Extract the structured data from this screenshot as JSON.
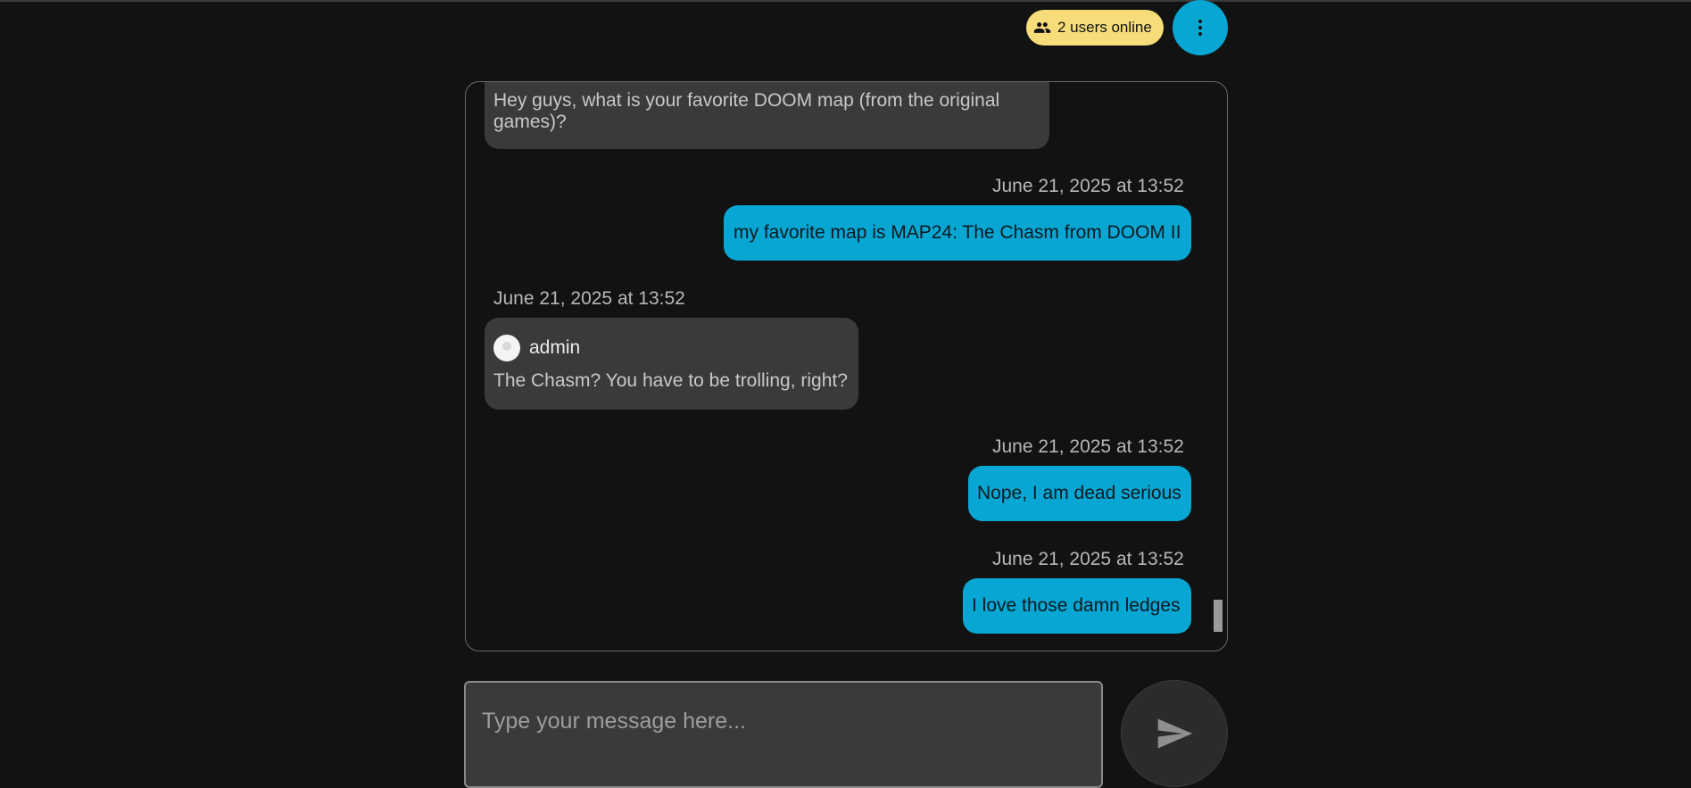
{
  "header": {
    "online_users": "2 users online",
    "menu_icon": "more-vertical-icon",
    "users_icon": "users-icon"
  },
  "messages": [
    {
      "type": "other",
      "text": "Hey guys, what is your favorite DOOM map (from the original games)?"
    },
    {
      "type": "self",
      "timestamp": "June 21, 2025 at 13:52",
      "text": "my favorite map is MAP24: The Chasm from DOOM II"
    },
    {
      "type": "other",
      "timestamp": "June 21, 2025 at 13:52",
      "sender": "admin",
      "text": "The Chasm? You have to be trolling, right?"
    },
    {
      "type": "self",
      "timestamp": "June 21, 2025 at 13:52",
      "text": "Nope, I am dead serious"
    },
    {
      "type": "self",
      "timestamp": "June 21, 2025 at 13:52",
      "text": "I love those damn ledges"
    }
  ],
  "composer": {
    "placeholder": "Type your message here...",
    "send_icon": "send-icon"
  },
  "colors": {
    "background": "#121212",
    "accent": "#08a6d3",
    "badge": "#f7dc7a",
    "bubble_other": "#3a3a3a"
  }
}
